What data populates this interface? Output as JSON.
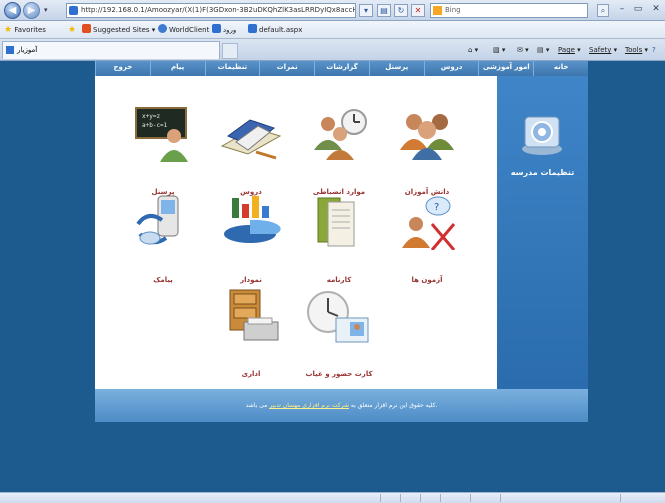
{
  "browser": {
    "url": "http://192.168.0.1/Amoozyar/(X(1)F(3GDxon-3B2uDKQhZlK3asLRRDyIQx8accHwmkxA1rov",
    "search_placeholder": "Bing",
    "favorites_label": "Favorites",
    "favorites": [
      "Suggested Sites ▾",
      "WorldClient",
      "ورود",
      "default.aspx"
    ],
    "tab_title": "آموزیار",
    "commands": {
      "page": "Page",
      "safety": "Safety",
      "tools": "Tools"
    }
  },
  "menu": {
    "items": [
      "خانه",
      "امور آموزشی",
      "دروس",
      "پرسنل",
      "گزارشات",
      "نمرات",
      "تنظیمات",
      "پیام",
      "خروج"
    ]
  },
  "sidebar": {
    "label": "تنظیمات مدرسه"
  },
  "tiles": [
    {
      "label": "دانش آموزان",
      "icon": "students-icon"
    },
    {
      "label": "موارد انضباطی",
      "icon": "discipline-icon"
    },
    {
      "label": "دروس",
      "icon": "books-icon"
    },
    {
      "label": "پرسنل",
      "icon": "teacher-icon"
    },
    {
      "label": "آزمون ها",
      "icon": "exam-icon"
    },
    {
      "label": "کارنامه",
      "icon": "report-card-icon"
    },
    {
      "label": "نمودار",
      "icon": "chart-icon"
    },
    {
      "label": "پیامک",
      "icon": "sms-icon"
    },
    {
      "label": "کارت حضور و غیاب",
      "icon": "attendance-card-icon"
    },
    {
      "label": "اداری",
      "icon": "office-icon"
    }
  ],
  "footer": {
    "text_before": "کلیه حقوق این نرم افزار متعلق به ",
    "link": "شرکت نرم افزاری مهسان تدبیر",
    "text_after": " می باشد."
  },
  "colors": {
    "page_bg": "#1d5a8e",
    "tile_label": "#993333",
    "menu_bg": "#3c76ad"
  }
}
